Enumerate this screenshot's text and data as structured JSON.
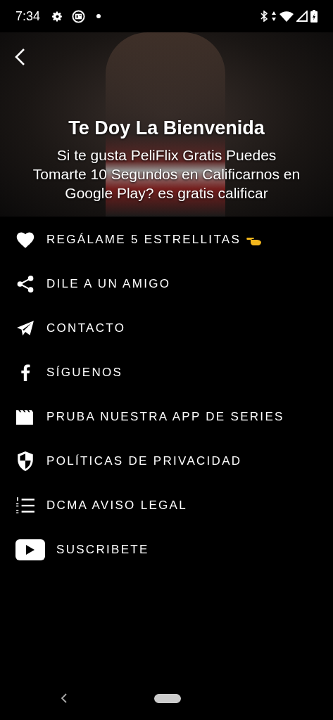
{
  "status_bar": {
    "time": "7:34"
  },
  "header": {
    "title": "Te Doy La Bienvenida",
    "subtitle": "Si te gusta PeliFlix Gratis Puedes Tomarte 10 Segundos en Calificarnos en Google Play? es gratis calificar"
  },
  "menu": [
    {
      "kind": "heart",
      "label": "REGÁLAME 5 ESTRELLITAS",
      "pointing_hand": true
    },
    {
      "kind": "share",
      "label": "DILE A UN AMIGO"
    },
    {
      "kind": "send",
      "label": "CONTACTO"
    },
    {
      "kind": "facebook",
      "label": "SÍGUENOS"
    },
    {
      "kind": "clapper",
      "label": "PRUBA NUESTRA APP DE SERIES"
    },
    {
      "kind": "shield",
      "label": "POLÍTICAS DE PRIVACIDAD"
    },
    {
      "kind": "list",
      "label": "DCMA AVISO LEGAL"
    },
    {
      "kind": "youtube",
      "label": "SUSCRIBETE"
    }
  ]
}
